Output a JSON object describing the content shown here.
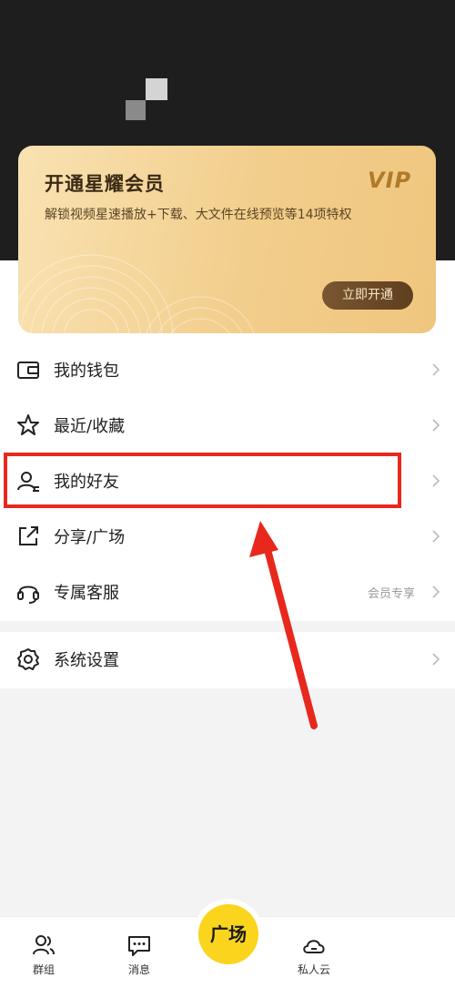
{
  "vip_card": {
    "title": "开通星耀会员",
    "description": "解锁视频星速播放+下载、大文件在线预览等14项特权",
    "logo": "VIP",
    "button_label": "立即开通"
  },
  "menu": {
    "items": [
      {
        "label": "我的钱包",
        "icon": "wallet-icon"
      },
      {
        "label": "最近/收藏",
        "icon": "star-icon"
      },
      {
        "label": "我的好友",
        "icon": "friends-icon"
      },
      {
        "label": "分享/广场",
        "icon": "share-icon"
      },
      {
        "label": "专属客服",
        "icon": "headset-icon",
        "extra": "会员专享"
      }
    ],
    "settings": {
      "label": "系统设置",
      "icon": "gear-icon"
    }
  },
  "bottom_nav": {
    "tabs": [
      {
        "label": "群组",
        "icon": "group-icon"
      },
      {
        "label": "消息",
        "icon": "message-icon"
      },
      {
        "label": "私人云",
        "icon": "cloud-icon"
      }
    ],
    "center_label": "广场"
  },
  "colors": {
    "highlight": "#e8281d",
    "center_button": "#fbd41d",
    "vip_gold": "#f2ce8c"
  }
}
